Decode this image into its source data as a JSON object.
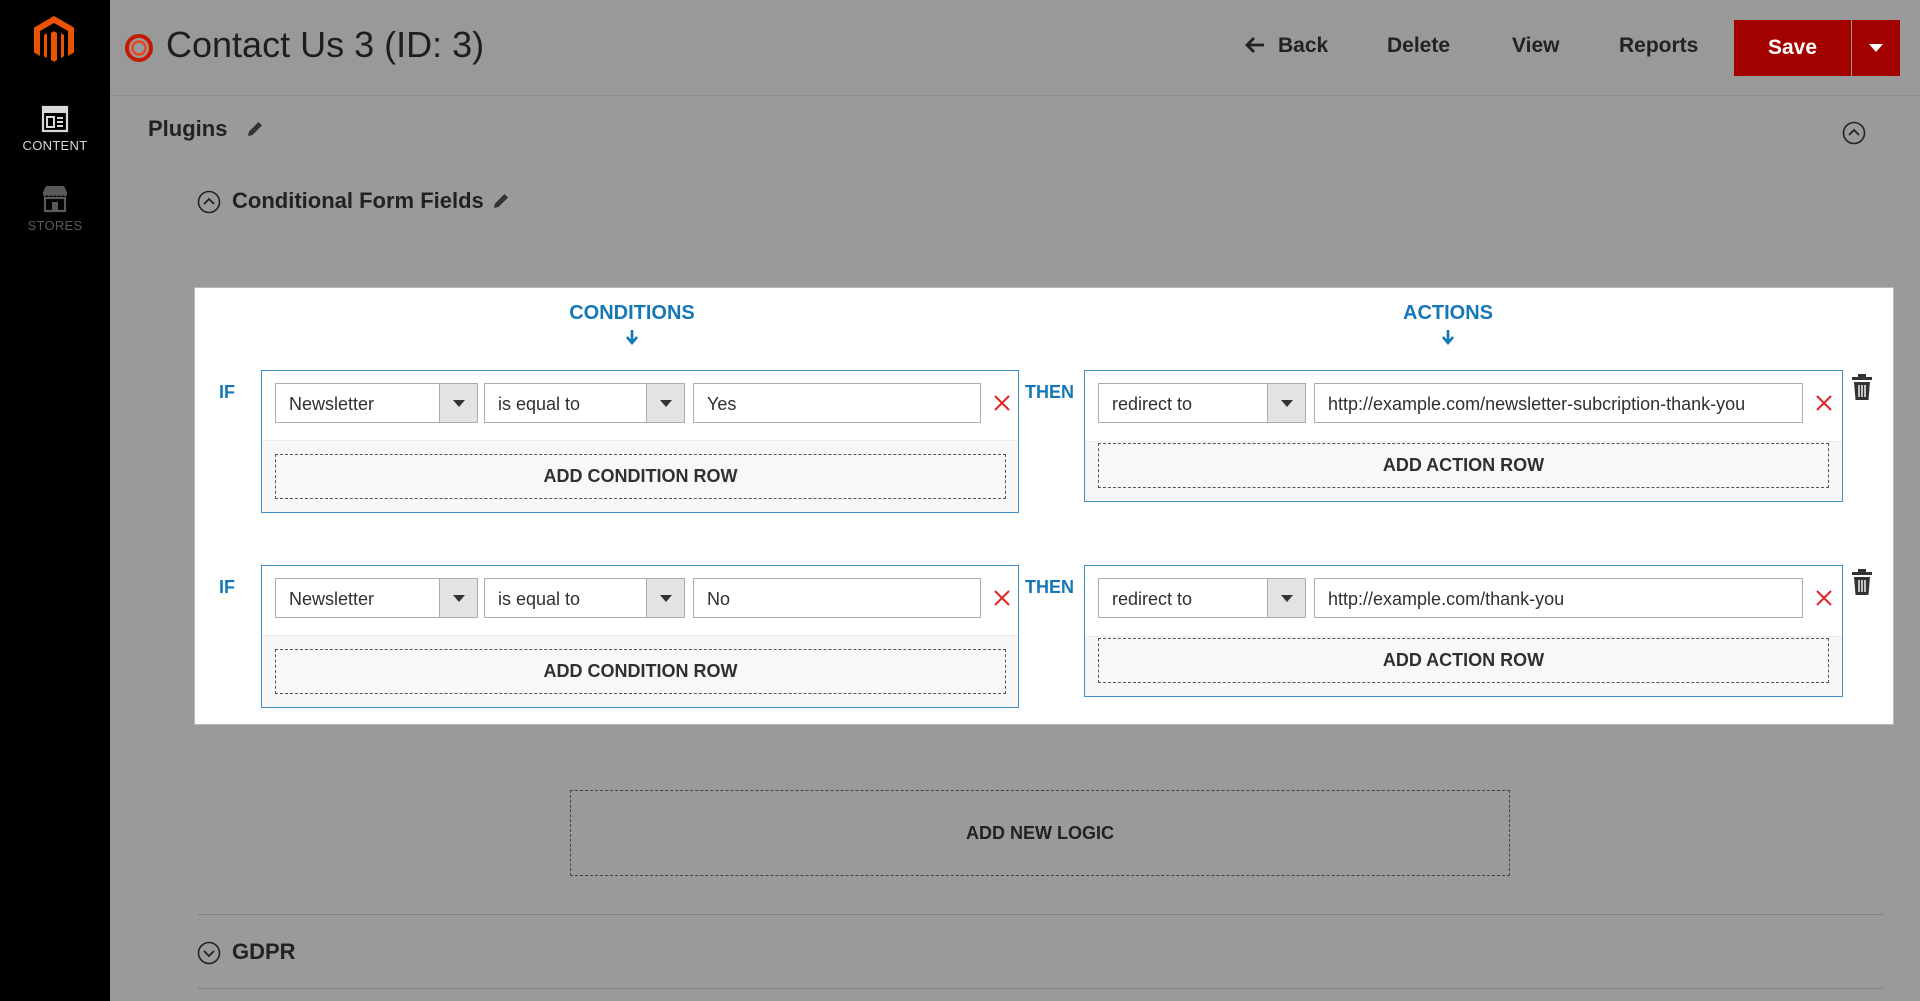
{
  "app": {
    "brand_color": "#eb5202",
    "accent_color": "#1677b6",
    "save_color": "#a30000"
  },
  "sidebar": {
    "items": [
      {
        "label": "CONTENT",
        "icon": "content-icon",
        "active": true
      },
      {
        "label": "STORES",
        "icon": "stores-icon",
        "active": false
      }
    ]
  },
  "header": {
    "title": "Contact Us 3 (ID: 3)",
    "back_label": "Back",
    "delete_label": "Delete",
    "view_label": "View",
    "reports_label": "Reports",
    "save_label": "Save"
  },
  "plugins": {
    "title": "Plugins",
    "conditional": {
      "title": "Conditional Form Fields",
      "conditions_heading": "CONDITIONS",
      "actions_heading": "ACTIONS",
      "if_label": "IF",
      "then_label": "THEN",
      "add_condition_label": "ADD CONDITION ROW",
      "add_action_label": "ADD ACTION ROW",
      "logic": [
        {
          "condition": {
            "field": "Newsletter",
            "operator": "is equal to",
            "value": "Yes"
          },
          "action": {
            "type": "redirect to",
            "value": "http://example.com/newsletter-subcription-thank-you"
          }
        },
        {
          "condition": {
            "field": "Newsletter",
            "operator": "is equal to",
            "value": "No"
          },
          "action": {
            "type": "redirect to",
            "value": "http://example.com/thank-you"
          }
        }
      ],
      "add_logic_label": "ADD NEW LOGIC"
    },
    "gdpr_title": "GDPR"
  }
}
